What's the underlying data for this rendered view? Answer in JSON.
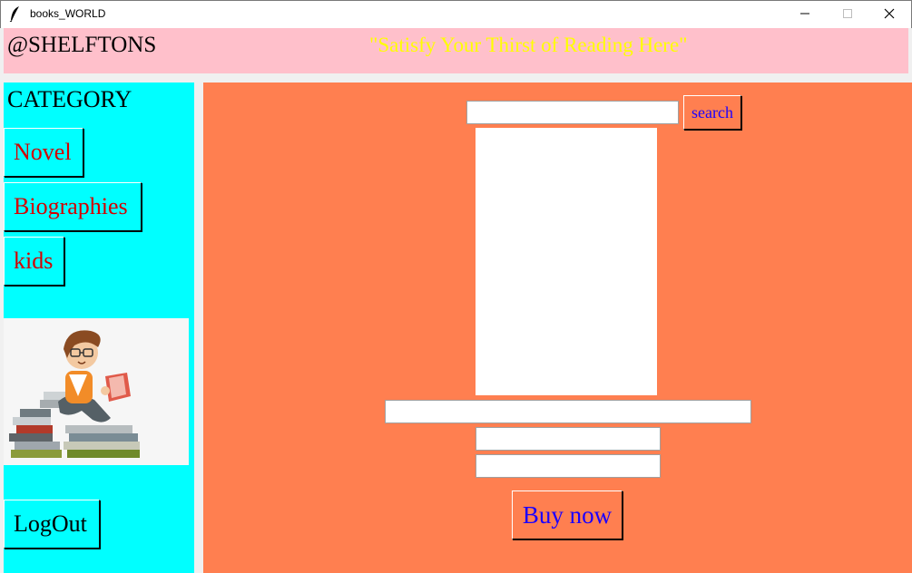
{
  "window": {
    "title": "books_WORLD",
    "app_icon": "feather-icon",
    "controls": {
      "minimize": "minimize-icon",
      "maximize": "maximize-icon",
      "close": "close-icon"
    }
  },
  "header": {
    "brand": "@SHELFTONS",
    "slogan": "\"Satisfy Your Thirst of Reading Here\""
  },
  "sidebar": {
    "heading": "CATEGORY",
    "categories": [
      {
        "label": "Novel"
      },
      {
        "label": "Biographies"
      },
      {
        "label": "kids"
      }
    ],
    "illustration": "boy-reading-on-books-illustration",
    "logout_label": "LogOut"
  },
  "main": {
    "search": {
      "value": "",
      "button_label": "search"
    },
    "book_cover": "blank-image",
    "title_value": "",
    "author_value": "",
    "price_value": "",
    "buy_label": "Buy now"
  },
  "colors": {
    "header_bg": "#ffc0cb",
    "slogan": "#ffff00",
    "sidebar_bg": "#00ffff",
    "category_text": "#d40000",
    "main_bg": "#ff7f50",
    "action_text": "#1c00ff"
  }
}
